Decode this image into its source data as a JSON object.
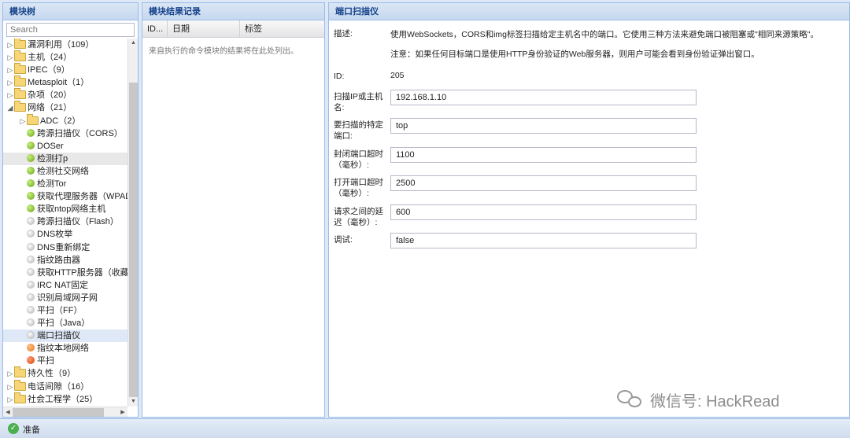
{
  "tree_panel": {
    "title": "模块树",
    "search_placeholder": "Search",
    "items": [
      {
        "label": "漏洞利用（109）",
        "type": "folder",
        "level": 0,
        "expanded": false
      },
      {
        "label": "主机（24）",
        "type": "folder",
        "level": 0,
        "expanded": false
      },
      {
        "label": "IPEC（9）",
        "type": "folder",
        "level": 0,
        "expanded": false
      },
      {
        "label": "Metasploit（1）",
        "type": "folder",
        "level": 0,
        "expanded": false
      },
      {
        "label": "杂项（20）",
        "type": "folder",
        "level": 0,
        "expanded": false
      },
      {
        "label": "网络（21）",
        "type": "folder",
        "level": 0,
        "expanded": true
      },
      {
        "label": "ADC（2）",
        "type": "folder",
        "level": 1,
        "expanded": false
      },
      {
        "label": "跨源扫描仪（CORS）",
        "type": "module",
        "status": "green",
        "level": 1
      },
      {
        "label": "DOSer",
        "type": "module",
        "status": "green",
        "level": 1
      },
      {
        "label": "检测打p",
        "type": "module",
        "status": "green",
        "level": 1,
        "highlight": "light"
      },
      {
        "label": "检测社交网络",
        "type": "module",
        "status": "green",
        "level": 1
      },
      {
        "label": "检测Tor",
        "type": "module",
        "status": "green",
        "level": 1
      },
      {
        "label": "获取代理服务器（WPAD",
        "type": "module",
        "status": "green",
        "level": 1
      },
      {
        "label": "获取ntop网络主机",
        "type": "module",
        "status": "green",
        "level": 1
      },
      {
        "label": "跨源扫描仪（Flash）",
        "type": "module",
        "status": "grey",
        "level": 1
      },
      {
        "label": "DNS枚举",
        "type": "module",
        "status": "grey",
        "level": 1
      },
      {
        "label": "DNS重新绑定",
        "type": "module",
        "status": "grey",
        "level": 1
      },
      {
        "label": "指纹路由器",
        "type": "module",
        "status": "grey",
        "level": 1
      },
      {
        "label": "获取HTTP服务器（收藏",
        "type": "module",
        "status": "grey",
        "level": 1
      },
      {
        "label": "IRC NAT固定",
        "type": "module",
        "status": "grey",
        "level": 1
      },
      {
        "label": "识别局域网子网",
        "type": "module",
        "status": "grey",
        "level": 1
      },
      {
        "label": "平扫（FF）",
        "type": "module",
        "status": "grey",
        "level": 1
      },
      {
        "label": "平扫（Java）",
        "type": "module",
        "status": "grey",
        "level": 1
      },
      {
        "label": "端口扫描仪",
        "type": "module",
        "status": "grey",
        "level": 1,
        "highlight": "selected"
      },
      {
        "label": "指纹本地网络",
        "type": "module",
        "status": "orange",
        "level": 1
      },
      {
        "label": "平扫",
        "type": "module",
        "status": "red",
        "level": 1
      },
      {
        "label": "持久性（9）",
        "type": "folder",
        "level": 0,
        "expanded": false
      },
      {
        "label": "电话间隙（16）",
        "type": "folder",
        "level": 0,
        "expanded": false
      },
      {
        "label": "社会工程学（25）",
        "type": "folder",
        "level": 0,
        "expanded": false
      }
    ]
  },
  "results_panel": {
    "title": "模块结果记录",
    "columns": [
      "ID...",
      "日期",
      "标签"
    ],
    "empty_text": "来自执行的命令模块的结果将在此处列出。"
  },
  "detail_panel": {
    "title": "端口扫描仪",
    "description_label": "描述:",
    "description_line1": "使用WebSockets，CORS和img标签扫描给定主机名中的端口。它使用三种方法来避免端口被阻塞或\"相同来源策略\"。",
    "description_line2": "注意：如果任何目标端口是使用HTTP身份验证的Web服务器，则用户可能会看到身份验证弹出窗口。",
    "id_label": "ID:",
    "id_value": "205",
    "fields": [
      {
        "label": "扫描IP或主机名:",
        "value": "192.168.1.10"
      },
      {
        "label": "要扫描的特定端口:",
        "value": "top"
      },
      {
        "label": "封闭端口超时（毫秒）:",
        "value": "1100"
      },
      {
        "label": "打开端口超时（毫秒）:",
        "value": "2500"
      },
      {
        "label": "请求之间的延迟（毫秒）:",
        "value": "600"
      },
      {
        "label": "调试:",
        "value": "false"
      }
    ]
  },
  "status_bar": {
    "text": "准备"
  },
  "watermark": {
    "text": "微信号: HackRead"
  }
}
